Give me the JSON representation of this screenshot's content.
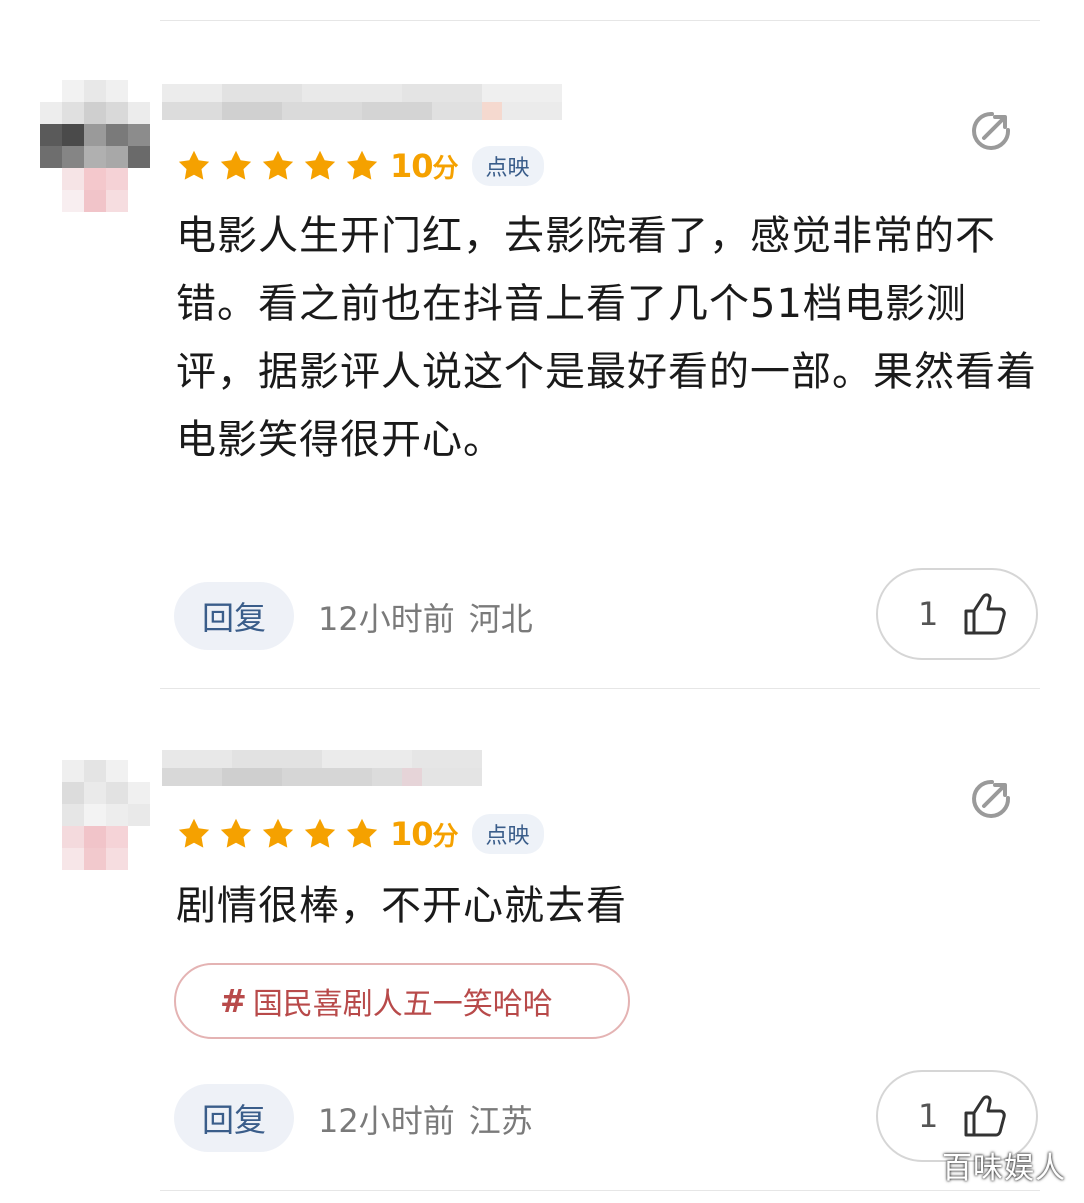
{
  "comments": [
    {
      "score": "10",
      "score_unit": "分",
      "source": "点映",
      "text": "电影人生开门红，去影院看了，感觉非常的不错。看之前也在抖音上看了几个51档电影测评，据影评人说这个是最好看的一部。果然看着电影笑得很开心。",
      "reply_label": "回复",
      "time": "12小时前",
      "location": "河北",
      "likes": "1"
    },
    {
      "score": "10",
      "score_unit": "分",
      "source": "点映",
      "text": "剧情很棒，不开心就去看",
      "topic_hash": "#",
      "topic": "国民喜剧人五一笑哈哈",
      "reply_label": "回复",
      "time": "12小时前",
      "location": "江苏",
      "likes": "1"
    }
  ],
  "icons": {
    "star": "star-icon",
    "share": "share-icon",
    "like": "thumbs-up-icon"
  },
  "colors": {
    "star": "#f5a100",
    "accent_blue": "#3a5d8a",
    "topic_red": "#b84a4a"
  },
  "watermark": "百味娱人"
}
